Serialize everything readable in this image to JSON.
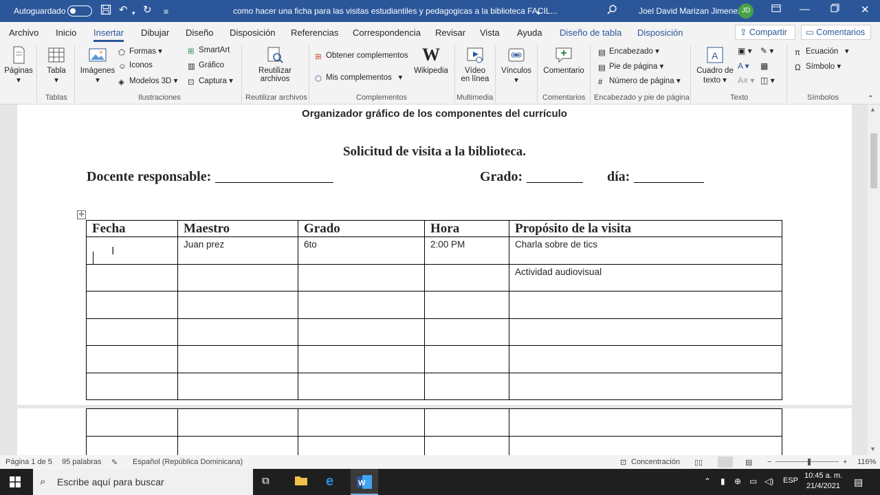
{
  "titlebar": {
    "autosave_label": "Autoguardado",
    "document_title": "como hacer  una ficha para las visitas estudiantiles y pedagogicas  a la biblioteca FACIL...",
    "user_name": "Joel David Marizan Jimenez",
    "user_initials": "JD"
  },
  "tabs": [
    "Archivo",
    "Inicio",
    "Insertar",
    "Dibujar",
    "Diseño",
    "Disposición",
    "Referencias",
    "Correspondencia",
    "Revisar",
    "Vista",
    "Ayuda",
    "Diseño de tabla",
    "Disposición"
  ],
  "share_label": "Compartir",
  "comments_label": "Comentarios",
  "ribbon": {
    "paginas": "Páginas",
    "tabla": "Tabla",
    "imagenes": "Imágenes",
    "formas": "Formas",
    "iconos": "Iconos",
    "modelos3d": "Modelos 3D",
    "smartart": "SmartArt",
    "grafico": "Gráfico",
    "captura": "Captura",
    "reutilizar": "Reutilizar archivos",
    "obtener": "Obtener complementos",
    "mis": "Mis complementos",
    "wikipedia": "Wikipedia",
    "video": "Vídeo en línea",
    "vinculos": "Vínculos",
    "comentario": "Comentario",
    "encabezado": "Encabezado",
    "pie": "Pie de página",
    "numero": "Número de página",
    "cuadro": "Cuadro de texto",
    "ecuacion": "Ecuación",
    "simbolo": "Símbolo",
    "groups": {
      "tablas": "Tablas",
      "ilustraciones": "Ilustraciones",
      "reutilizar": "Reutilizar archivos",
      "complementos": "Complementos",
      "multimedia": "Multimedia",
      "comentarios": "Comentarios",
      "encabezado": "Encabezado y pie de página",
      "texto": "Texto",
      "simbolos": "Símbolos"
    }
  },
  "document": {
    "subtitle": "Organizador gráfico de los componentes del currículo",
    "heading": "Solicitud de visita a la biblioteca.",
    "docente_label": "Docente responsable:",
    "grado_label": "Grado:",
    "dia_label": "día:",
    "table": {
      "headers": [
        "Fecha",
        "Maestro",
        "Grado",
        "Hora",
        "Propósito de la visita"
      ],
      "rows": [
        [
          "",
          "Juan prez",
          "6to",
          "2:00 PM",
          "Charla sobre de tics"
        ],
        [
          "",
          "",
          "",
          "",
          "Actividad audiovisual"
        ],
        [
          "",
          "",
          "",
          "",
          ""
        ],
        [
          "",
          "",
          "",
          "",
          ""
        ],
        [
          "",
          "",
          "",
          "",
          ""
        ],
        [
          "",
          "",
          "",
          "",
          ""
        ]
      ]
    }
  },
  "statusbar": {
    "page": "Página 1 de 5",
    "words": "95 palabras",
    "language": "Español (República Dominicana)",
    "focus": "Concentración",
    "zoom": "116%"
  },
  "taskbar": {
    "search_placeholder": "Escribe aquí para buscar",
    "lang": "ESP",
    "time": "10:45 a. m.",
    "date": "21/4/2021"
  }
}
